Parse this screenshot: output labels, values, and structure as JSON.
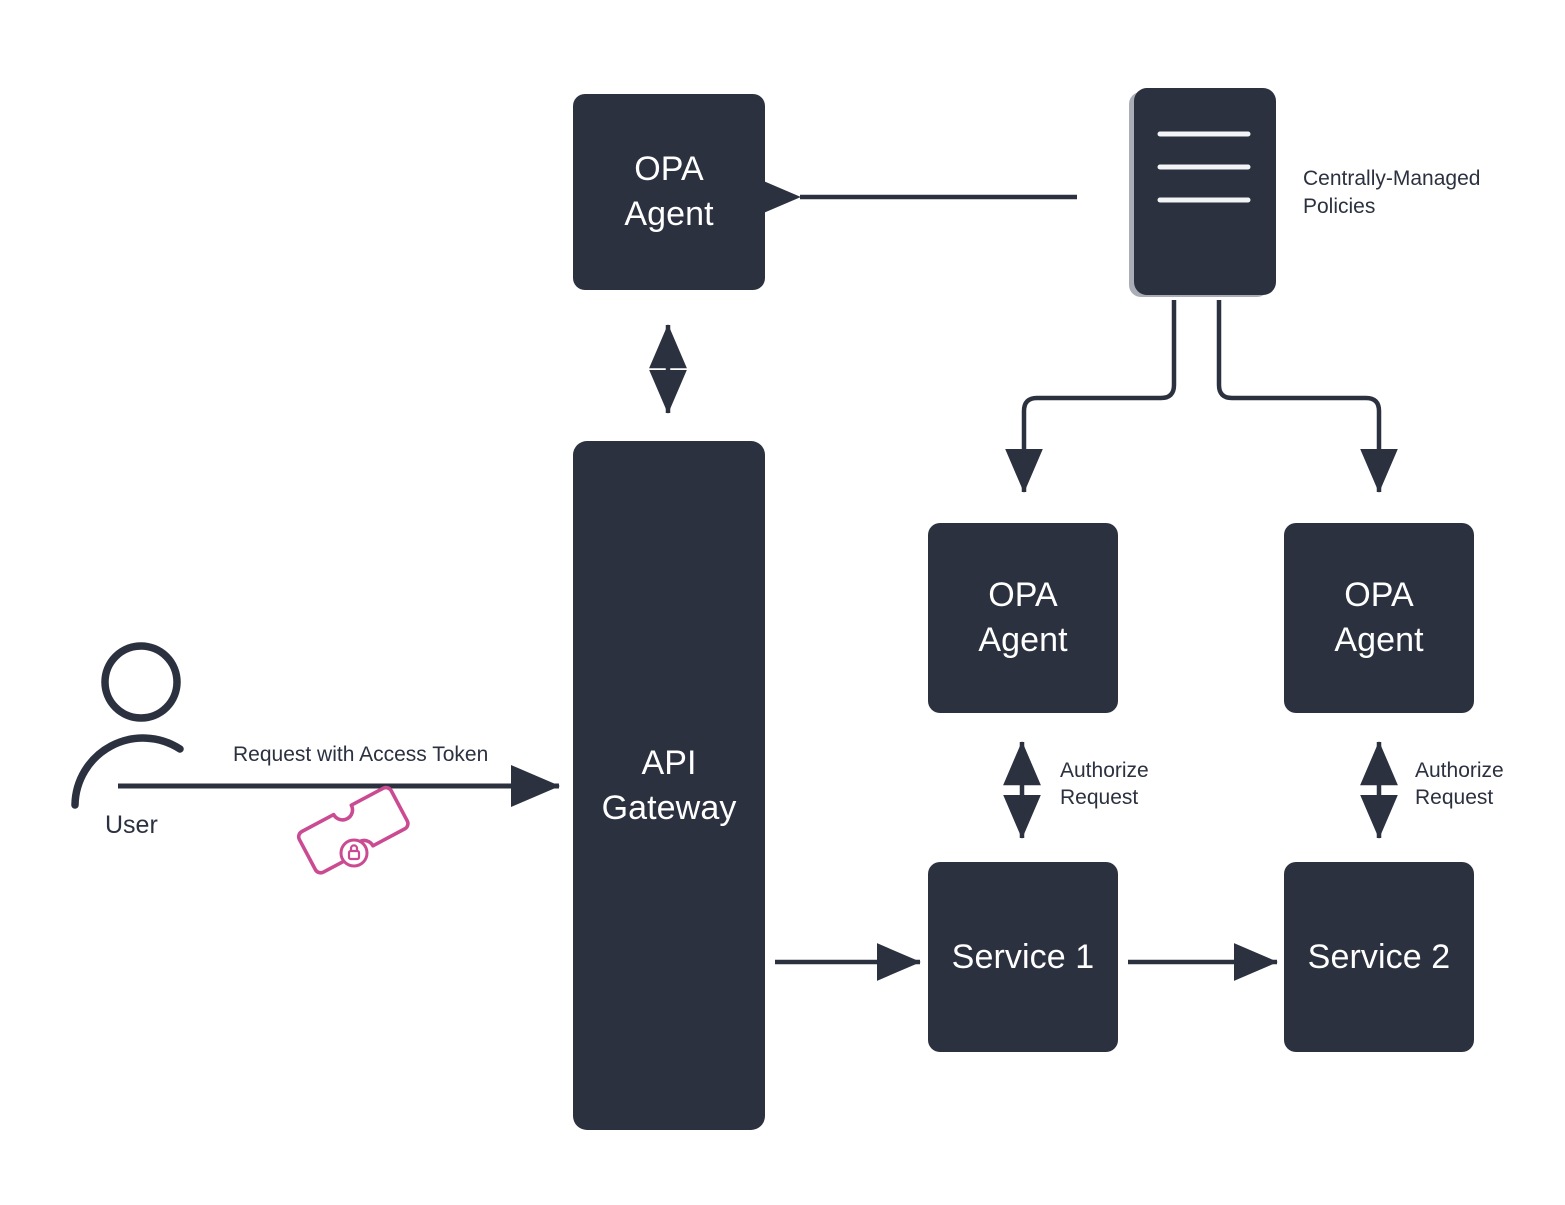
{
  "diagram": {
    "title": "OPA authorization architecture",
    "colors": {
      "node_fill": "#2c3140",
      "node_text": "#ffffff",
      "line": "#2c3140",
      "label_text": "#2c3140",
      "token_accent": "#cb4b92",
      "doc_shadow": "#a9adb6",
      "background": "#ffffff"
    },
    "nodes": {
      "opa_agent_gateway": "OPA\nAgent",
      "api_gateway": "API\nGateway",
      "opa_agent_service1": "OPA\nAgent",
      "opa_agent_service2": "OPA\nAgent",
      "service1": "Service 1",
      "service2": "Service 2"
    },
    "labels": {
      "policies": "Centrally-Managed\nPolicies",
      "user": "User",
      "request_with_token": "Request with Access Token",
      "authorize_request_1": "Authorize\nRequest",
      "authorize_request_2": "Authorize\nRequest"
    },
    "icons": {
      "policy_document": "document-lines-icon",
      "user_avatar": "user-icon",
      "access_token": "ticket-lock-icon"
    }
  }
}
